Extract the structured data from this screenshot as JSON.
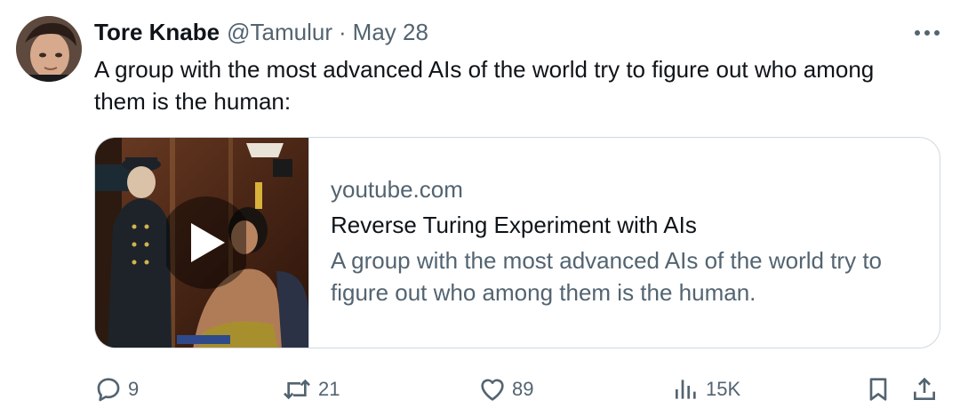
{
  "tweet": {
    "author_name": "Tore Knabe",
    "author_handle": "@Tamulur",
    "separator": "·",
    "date": "May 28",
    "text": "A group with the most advanced AIs of the world try to figure out who among them is the human:"
  },
  "card": {
    "domain": "youtube.com",
    "title": "Reverse Turing Experiment with AIs",
    "description": "A group with the most advanced AIs of the world try to figure out who among them is the human."
  },
  "actions": {
    "replies": "9",
    "reposts": "21",
    "likes": "89",
    "views": "15K"
  },
  "icons": {
    "more": "more-horizontal-icon",
    "play": "play-icon",
    "reply": "reply-icon",
    "repost": "repost-icon",
    "like": "heart-icon",
    "views": "views-chart-icon",
    "bookmark": "bookmark-icon",
    "share": "share-icon"
  },
  "colors": {
    "text": "#0f1419",
    "secondary": "#536471",
    "border": "#cfd9de"
  }
}
